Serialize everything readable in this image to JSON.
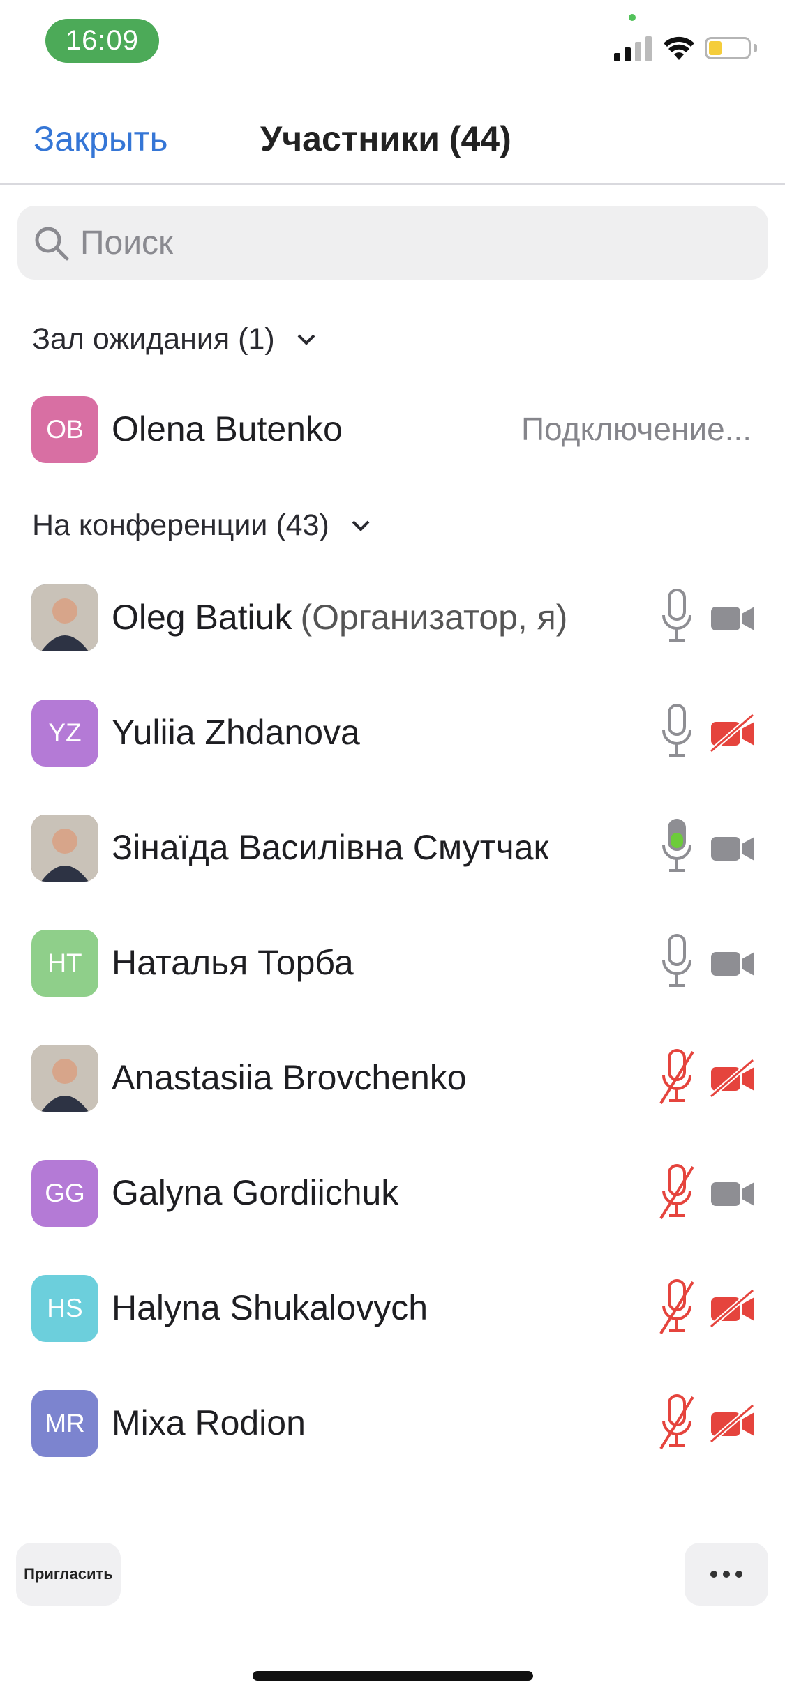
{
  "status_bar": {
    "time": "16:09"
  },
  "nav": {
    "close_label": "Закрыть",
    "title": "Участники (44)"
  },
  "search": {
    "placeholder": "Поиск",
    "value": ""
  },
  "waiting": {
    "header": "Зал ожидания (1)",
    "participants": [
      {
        "initials": "OB",
        "name": "Olena Butenko",
        "status": "Подключение...",
        "color": "#d86fa3"
      }
    ]
  },
  "meeting": {
    "header": "На конференции (43)",
    "participants": [
      {
        "initials": "",
        "name": "Oleg Batiuk",
        "role": "(Организатор, я)",
        "color": "#6b7d92",
        "photo": true,
        "mic": "on",
        "cam": "on"
      },
      {
        "initials": "YZ",
        "name": "Yuliia Zhdanova",
        "role": "",
        "color": "#b47ad6",
        "photo": false,
        "mic": "on",
        "cam": "off"
      },
      {
        "initials": "",
        "name": "Зінаїда Василівна Смутчак",
        "role": "",
        "color": "#8a6a5a",
        "photo": true,
        "mic": "speaking",
        "cam": "on"
      },
      {
        "initials": "HT",
        "name": "Наталья Торба",
        "role": "",
        "color": "#8fcf8a",
        "photo": false,
        "mic": "on",
        "cam": "on"
      },
      {
        "initials": "",
        "name": "Anastasiia Brovchenko",
        "role": "",
        "color": "#9a8a6e",
        "photo": true,
        "mic": "off",
        "cam": "off"
      },
      {
        "initials": "GG",
        "name": "Galyna Gordiichuk",
        "role": "",
        "color": "#b47ad6",
        "photo": false,
        "mic": "off",
        "cam": "on"
      },
      {
        "initials": "HS",
        "name": "Halyna Shukalovych",
        "role": "",
        "color": "#6ccfdc",
        "photo": false,
        "mic": "off",
        "cam": "off"
      },
      {
        "initials": "MR",
        "name": "Mixa Rodion",
        "role": "",
        "color": "#7c84cf",
        "photo": false,
        "mic": "off",
        "cam": "off"
      }
    ]
  },
  "footer": {
    "invite_label": "Пригласить",
    "more_icon": "ellipsis-icon"
  },
  "colors": {
    "accent": "#3576d6",
    "muted_red": "#e5443d",
    "speaking_green": "#6ccc3a",
    "icon_gray": "#8e8e93"
  }
}
